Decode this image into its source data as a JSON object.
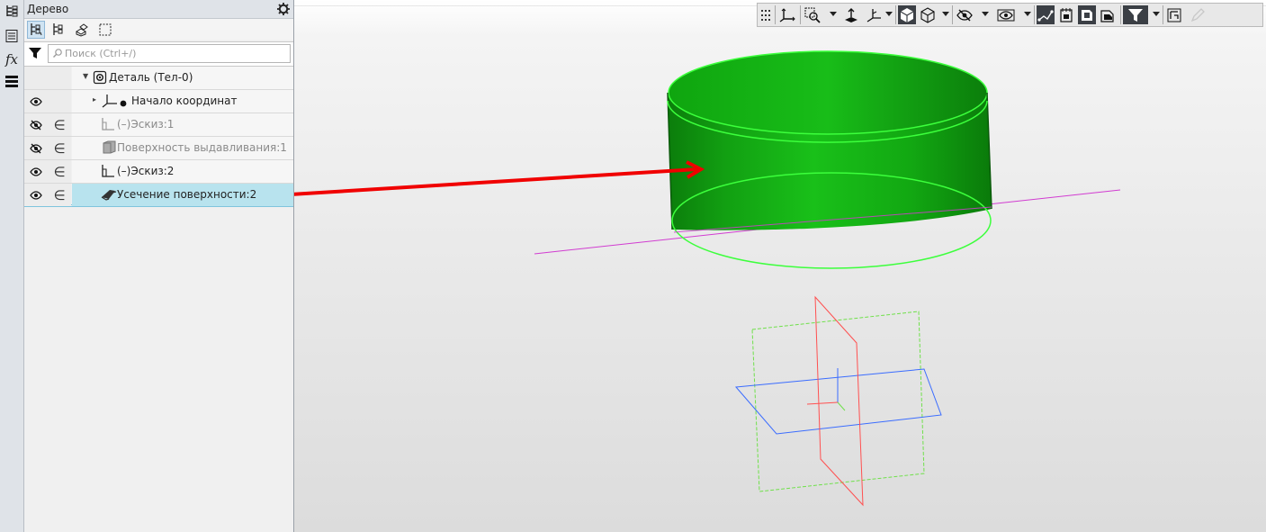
{
  "panel": {
    "title": "Дерево",
    "search_placeholder": "Поиск (Ctrl+/)"
  },
  "tree": {
    "root": "Деталь (Тел-0)",
    "items": [
      {
        "label": "Начало координат",
        "eye": true,
        "include": false,
        "dim": false
      },
      {
        "label": "(–)Эскиз:1",
        "eye": false,
        "include": true,
        "dim": true
      },
      {
        "label": "Поверхность выдавливания:1",
        "eye": false,
        "include": true,
        "dim": true
      },
      {
        "label": "(–)Эскиз:2",
        "eye": true,
        "include": true,
        "dim": false
      },
      {
        "label": "Усечение поверхности:2",
        "eye": true,
        "include": true,
        "dim": false,
        "selected": true
      }
    ],
    "include_symbol": "∈"
  },
  "icons": {
    "strip": [
      "tree-icon",
      "properties-icon",
      "variables-fx-icon",
      "layers-icon"
    ],
    "strip_fx": "fx",
    "panel_tools": [
      "build-tree-icon",
      "structure-tree-icon",
      "bodies-icon",
      "select-icon"
    ],
    "view_toolbar": [
      "grid-icon",
      "coordinate-system-icon",
      "zoom-icon",
      "orient-icon",
      "triad-icon",
      "shaded-icon",
      "wireframe-icon",
      "hide-icon",
      "show-all-icon",
      "snap-icon",
      "section-icon",
      "perspective-icon",
      "layers-view-icon",
      "filter-icon",
      "measure-icon",
      "pencil-icon"
    ]
  },
  "colors": {
    "body_green": "#0fae0f",
    "body_edge": "#3cff3c",
    "arrow": "#f00000",
    "axis_line": "#d13cd1",
    "plane_blue": "#3a6cff",
    "plane_red": "#ff5050",
    "plane_green": "#6fe04a",
    "selection": "#b8e3ee"
  }
}
